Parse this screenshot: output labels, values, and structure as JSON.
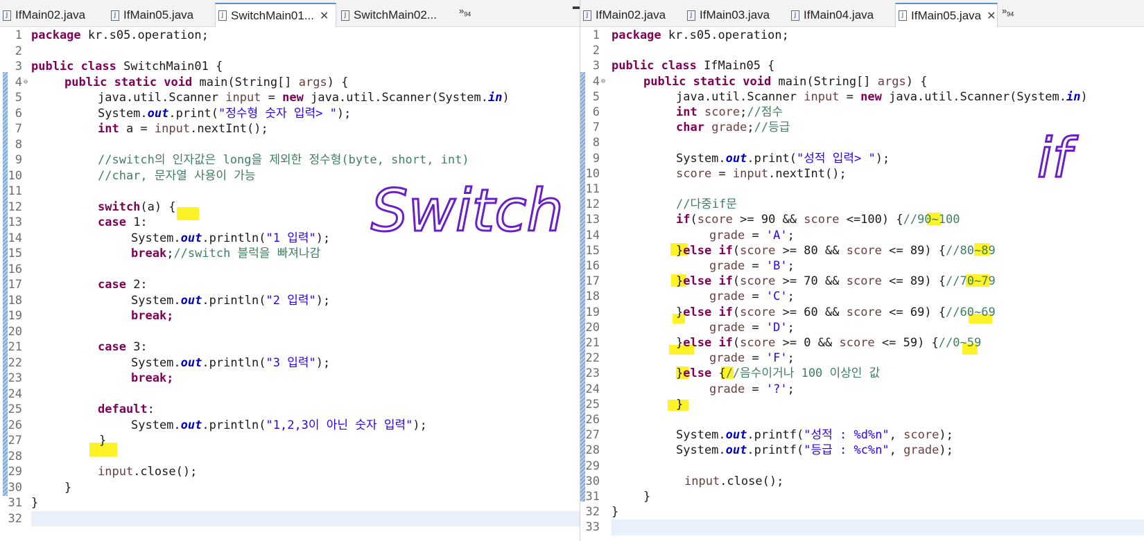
{
  "left": {
    "tabs": [
      {
        "label": "IfMain02.java"
      },
      {
        "label": "IfMain05.java"
      },
      {
        "label": "SwitchMain01..."
      },
      {
        "label": "SwitchMain02..."
      }
    ],
    "overflow": {
      "label": "»",
      "count": "94"
    },
    "code": {
      "pkg": "package",
      "pkg_name": " kr.s05.operation;",
      "l3_kw": "public class",
      "l3_rest": " SwitchMain01 {",
      "l4_kw": "public static void",
      "l4_rest": " main(String[] ",
      "args": "args",
      "l4_end": ") {",
      "l5_a": "java.util.Scanner ",
      "input": "input",
      "l5_b": " = ",
      "new": "new",
      "l5_c": " java.util.Scanner(System.",
      "in": "in",
      "l5_d": ")",
      "system": "System.",
      "out": "out",
      "l6_b": ".print(",
      "l6_str": "\"정수형 숫자 입력> \"",
      "l6_c": ");",
      "int": "int",
      "l7_a": " a = ",
      "l7_b": ".nextInt();",
      "l9_cm": "//switch의 인자값은 long을 제외한 정수형(byte, short, int)",
      "l10_cm": "//char, 문자열 사용이 가능",
      "switch": "switch",
      "l12_b": "(a) {",
      "case": "case",
      "l13_b": " 1:",
      "l14_b": ".println(",
      "l14_str": "\"1 입력\"",
      "l14_c": ");",
      "break": "break",
      "l15_b": ";",
      "l15_cm": "//switch 블럭을 빠져나감",
      "l17_b": " 2:",
      "l18_str": "\"2 입력\"",
      "break2": "break;",
      "l21_b": " 3:",
      "l22_str": "\"3 입력\"",
      "default": "default",
      "l25_b": ":",
      "l26_str": "\"1,2,3이 아닌 숫자 입력\"",
      "brace_close": "}",
      "l29": ".close();"
    },
    "annotation": "Switch"
  },
  "right": {
    "tabs": [
      {
        "label": "IfMain02.java"
      },
      {
        "label": "IfMain03.java"
      },
      {
        "label": "IfMain04.java"
      },
      {
        "label": "IfMain05.java"
      }
    ],
    "overflow": {
      "label": "»",
      "count": "94"
    },
    "code": {
      "l3_rest": " IfMain05 {",
      "score": "score",
      "l6_cm": "//점수",
      "char": "char",
      "grade": "grade",
      "l7_cm": "//등급",
      "l9_str": "\"성적 입력> \"",
      "l10_b": " = ",
      "l10_c": ".nextInt();",
      "l12_cm": "//다중if문",
      "if": "if",
      "l13_b": "(",
      "l13_c": " >= 90 && ",
      "l13_d": " <=100) {",
      "l13_cm": "//90~100",
      "l14_b": " = ",
      "l14_str": "'A'",
      "semi": ";",
      "else_if_pre": "}",
      "else": "else",
      "sp_if": " if",
      "l15_c": " >= 80 && ",
      "l15_d": " <= 89) {",
      "l15_cm": "//80~89",
      "l16_str": "'B'",
      "l17_c": " >= 70 && ",
      "l17_d": " <= 89) {",
      "l17_cm": "//70~79",
      "l18_str": "'C'",
      "l19_c": " >= 60 && ",
      "l19_d": " <= 69) {",
      "l19_cm": "//60~69",
      "l20_str": "'D'",
      "l21_c": " >= 0 && ",
      "l21_d": " <= 59) {",
      "l21_cm": "//0~59",
      "l22_str": "'F'",
      "l23_b": " {",
      "l23_cm": "//음수이거나 100 이상인 값",
      "l24_str": "'?'",
      "l27_b": ".printf(",
      "l27_str": "\"성적 : %d%n\"",
      "l27_c": ", ",
      "l27_d": ");",
      "l28_str": "\"등급 : %c%n\""
    },
    "annotation": "if"
  }
}
